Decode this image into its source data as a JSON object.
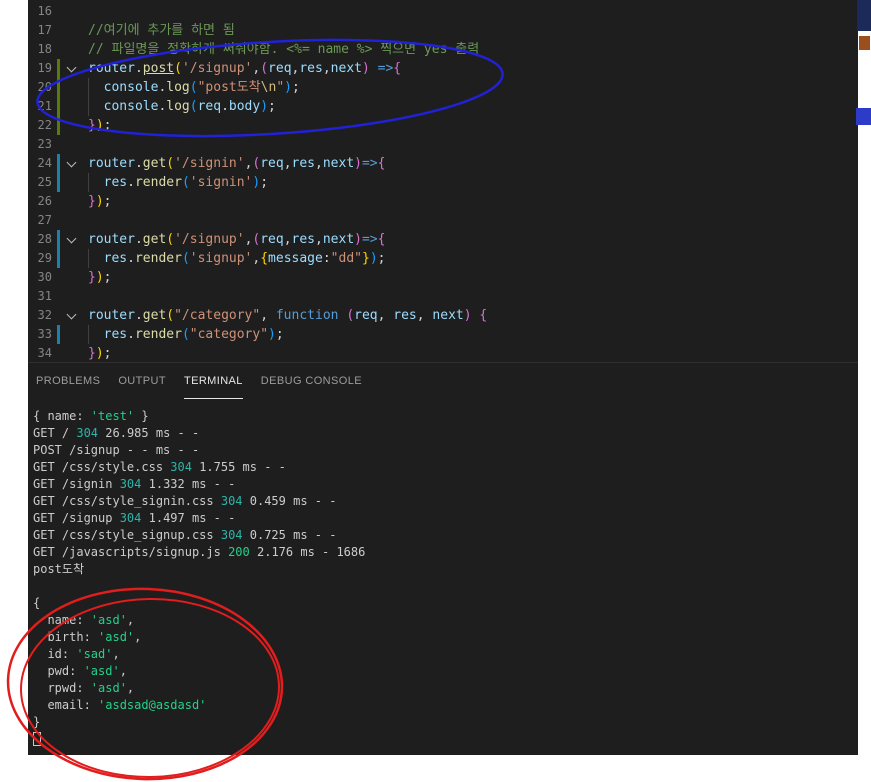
{
  "annotations": {
    "blue_pen_color": "#2121d8",
    "red_pen_color": "#e11d1d"
  },
  "editor": {
    "background": "#1e1e1e",
    "lines": [
      {
        "num": "16",
        "tokens": []
      },
      {
        "num": "17",
        "tokens": [
          {
            "c": "comment",
            "t": "//여기에 추가를 하면 됨"
          }
        ]
      },
      {
        "num": "18",
        "tokens": [
          {
            "c": "comment",
            "t": "// 파일명을 정확하게 써줘야함. <%= name %> 찍으면 yes 출력"
          }
        ]
      },
      {
        "num": "19",
        "gutter": "added",
        "fold": true,
        "tokens": [
          {
            "c": "var",
            "t": "router"
          },
          {
            "c": "def",
            "t": "."
          },
          {
            "c": "func",
            "t": "post",
            "u": true
          },
          {
            "c": "gold",
            "t": "("
          },
          {
            "c": "str",
            "t": "'/signup'"
          },
          {
            "c": "def",
            "t": ","
          },
          {
            "c": "pink",
            "t": "("
          },
          {
            "c": "var",
            "t": "req"
          },
          {
            "c": "def",
            "t": ","
          },
          {
            "c": "var",
            "t": "res"
          },
          {
            "c": "def",
            "t": ","
          },
          {
            "c": "var",
            "t": "next"
          },
          {
            "c": "pink",
            "t": ")"
          },
          {
            "c": "kw",
            "t": " =>"
          },
          {
            "c": "pink",
            "t": "{"
          }
        ]
      },
      {
        "num": "20",
        "gutter": "added",
        "guide": true,
        "tokens": [
          {
            "c": "def",
            "t": "  "
          },
          {
            "c": "var",
            "t": "console"
          },
          {
            "c": "def",
            "t": "."
          },
          {
            "c": "func",
            "t": "log"
          },
          {
            "c": "blue",
            "t": "("
          },
          {
            "c": "str",
            "t": "\"post도착"
          },
          {
            "c": "esc",
            "t": "\\n"
          },
          {
            "c": "str",
            "t": "\""
          },
          {
            "c": "blue",
            "t": ")"
          },
          {
            "c": "def",
            "t": ";"
          }
        ]
      },
      {
        "num": "21",
        "gutter": "added",
        "guide": true,
        "tokens": [
          {
            "c": "def",
            "t": "  "
          },
          {
            "c": "var",
            "t": "console"
          },
          {
            "c": "def",
            "t": "."
          },
          {
            "c": "func",
            "t": "log"
          },
          {
            "c": "blue",
            "t": "("
          },
          {
            "c": "var",
            "t": "req"
          },
          {
            "c": "def",
            "t": "."
          },
          {
            "c": "var",
            "t": "body"
          },
          {
            "c": "blue",
            "t": ")"
          },
          {
            "c": "def",
            "t": ";"
          }
        ]
      },
      {
        "num": "22",
        "gutter": "added",
        "tokens": [
          {
            "c": "pink",
            "t": "}"
          },
          {
            "c": "gold",
            "t": ")"
          },
          {
            "c": "def",
            "t": ";"
          }
        ]
      },
      {
        "num": "23",
        "tokens": []
      },
      {
        "num": "24",
        "gutter": "modified",
        "fold": true,
        "tokens": [
          {
            "c": "var",
            "t": "router"
          },
          {
            "c": "def",
            "t": "."
          },
          {
            "c": "func",
            "t": "get"
          },
          {
            "c": "gold",
            "t": "("
          },
          {
            "c": "str",
            "t": "'/signin'"
          },
          {
            "c": "def",
            "t": ","
          },
          {
            "c": "pink",
            "t": "("
          },
          {
            "c": "var",
            "t": "req"
          },
          {
            "c": "def",
            "t": ","
          },
          {
            "c": "var",
            "t": "res"
          },
          {
            "c": "def",
            "t": ","
          },
          {
            "c": "var",
            "t": "next"
          },
          {
            "c": "pink",
            "t": ")"
          },
          {
            "c": "kw",
            "t": "=>"
          },
          {
            "c": "pink",
            "t": "{"
          }
        ]
      },
      {
        "num": "25",
        "gutter": "modified",
        "guide": true,
        "tokens": [
          {
            "c": "def",
            "t": "  "
          },
          {
            "c": "var",
            "t": "res"
          },
          {
            "c": "def",
            "t": "."
          },
          {
            "c": "func",
            "t": "render"
          },
          {
            "c": "blue",
            "t": "("
          },
          {
            "c": "str",
            "t": "'signin'"
          },
          {
            "c": "blue",
            "t": ")"
          },
          {
            "c": "def",
            "t": ";"
          }
        ]
      },
      {
        "num": "26",
        "tokens": [
          {
            "c": "pink",
            "t": "}"
          },
          {
            "c": "gold",
            "t": ")"
          },
          {
            "c": "def",
            "t": ";"
          }
        ]
      },
      {
        "num": "27",
        "tokens": []
      },
      {
        "num": "28",
        "gutter": "modified",
        "fold": true,
        "tokens": [
          {
            "c": "var",
            "t": "router"
          },
          {
            "c": "def",
            "t": "."
          },
          {
            "c": "func",
            "t": "get"
          },
          {
            "c": "gold",
            "t": "("
          },
          {
            "c": "str",
            "t": "'/signup'"
          },
          {
            "c": "def",
            "t": ","
          },
          {
            "c": "pink",
            "t": "("
          },
          {
            "c": "var",
            "t": "req"
          },
          {
            "c": "def",
            "t": ","
          },
          {
            "c": "var",
            "t": "res"
          },
          {
            "c": "def",
            "t": ","
          },
          {
            "c": "var",
            "t": "next"
          },
          {
            "c": "pink",
            "t": ")"
          },
          {
            "c": "kw",
            "t": "=>"
          },
          {
            "c": "pink",
            "t": "{"
          }
        ]
      },
      {
        "num": "29",
        "gutter": "modified",
        "guide": true,
        "tokens": [
          {
            "c": "def",
            "t": "  "
          },
          {
            "c": "var",
            "t": "res"
          },
          {
            "c": "def",
            "t": "."
          },
          {
            "c": "func",
            "t": "render"
          },
          {
            "c": "blue",
            "t": "("
          },
          {
            "c": "str",
            "t": "'signup'"
          },
          {
            "c": "def",
            "t": ","
          },
          {
            "c": "gold",
            "t": "{"
          },
          {
            "c": "var",
            "t": "message"
          },
          {
            "c": "def",
            "t": ":"
          },
          {
            "c": "str",
            "t": "\"dd\""
          },
          {
            "c": "gold",
            "t": "}"
          },
          {
            "c": "blue",
            "t": ")"
          },
          {
            "c": "def",
            "t": ";"
          }
        ]
      },
      {
        "num": "30",
        "tokens": [
          {
            "c": "pink",
            "t": "}"
          },
          {
            "c": "gold",
            "t": ")"
          },
          {
            "c": "def",
            "t": ";"
          }
        ]
      },
      {
        "num": "31",
        "tokens": []
      },
      {
        "num": "32",
        "fold": true,
        "tokens": [
          {
            "c": "var",
            "t": "router"
          },
          {
            "c": "def",
            "t": "."
          },
          {
            "c": "func",
            "t": "get"
          },
          {
            "c": "gold",
            "t": "("
          },
          {
            "c": "str",
            "t": "\"/category\""
          },
          {
            "c": "def",
            "t": ", "
          },
          {
            "c": "kw",
            "t": "function"
          },
          {
            "c": "def",
            "t": " "
          },
          {
            "c": "pink",
            "t": "("
          },
          {
            "c": "var",
            "t": "req"
          },
          {
            "c": "def",
            "t": ", "
          },
          {
            "c": "var",
            "t": "res"
          },
          {
            "c": "def",
            "t": ", "
          },
          {
            "c": "var",
            "t": "next"
          },
          {
            "c": "pink",
            "t": ")"
          },
          {
            "c": "def",
            "t": " "
          },
          {
            "c": "pink",
            "t": "{"
          }
        ]
      },
      {
        "num": "33",
        "gutter": "modified",
        "guide": true,
        "tokens": [
          {
            "c": "def",
            "t": "  "
          },
          {
            "c": "var",
            "t": "res"
          },
          {
            "c": "def",
            "t": "."
          },
          {
            "c": "func",
            "t": "render"
          },
          {
            "c": "blue",
            "t": "("
          },
          {
            "c": "str",
            "t": "\"category\""
          },
          {
            "c": "blue",
            "t": ")"
          },
          {
            "c": "def",
            "t": ";"
          }
        ]
      },
      {
        "num": "34",
        "tokens": [
          {
            "c": "pink",
            "t": "}"
          },
          {
            "c": "gold",
            "t": ")"
          },
          {
            "c": "def",
            "t": ";"
          }
        ]
      }
    ]
  },
  "panel": {
    "tabs": [
      {
        "label": "PROBLEMS",
        "active": false
      },
      {
        "label": "OUTPUT",
        "active": false
      },
      {
        "label": "TERMINAL",
        "active": true
      },
      {
        "label": "DEBUG CONSOLE",
        "active": false
      }
    ],
    "terminal": [
      [
        {
          "c": "def",
          "t": "{ name: "
        },
        {
          "c": "green",
          "t": "'test'"
        },
        {
          "c": "def",
          "t": " }"
        }
      ],
      [
        {
          "c": "def",
          "t": "GET / "
        },
        {
          "c": "cyan",
          "t": "304"
        },
        {
          "c": "def",
          "t": " 26.985 ms - -"
        }
      ],
      [
        {
          "c": "def",
          "t": "POST /signup - - ms - -"
        }
      ],
      [
        {
          "c": "def",
          "t": "GET /css/style.css "
        },
        {
          "c": "cyan",
          "t": "304"
        },
        {
          "c": "def",
          "t": " 1.755 ms - -"
        }
      ],
      [
        {
          "c": "def",
          "t": "GET /signin "
        },
        {
          "c": "cyan",
          "t": "304"
        },
        {
          "c": "def",
          "t": " 1.332 ms - -"
        }
      ],
      [
        {
          "c": "def",
          "t": "GET /css/style_signin.css "
        },
        {
          "c": "cyan",
          "t": "304"
        },
        {
          "c": "def",
          "t": " 0.459 ms - -"
        }
      ],
      [
        {
          "c": "def",
          "t": "GET /signup "
        },
        {
          "c": "cyan",
          "t": "304"
        },
        {
          "c": "def",
          "t": " 1.497 ms - -"
        }
      ],
      [
        {
          "c": "def",
          "t": "GET /css/style_signup.css "
        },
        {
          "c": "cyan",
          "t": "304"
        },
        {
          "c": "def",
          "t": " 0.725 ms - -"
        }
      ],
      [
        {
          "c": "def",
          "t": "GET /javascripts/signup.js "
        },
        {
          "c": "green",
          "t": "200"
        },
        {
          "c": "def",
          "t": " 2.176 ms - 1686"
        }
      ],
      [
        {
          "c": "def",
          "t": "post도착"
        }
      ],
      [],
      [
        {
          "c": "def",
          "t": "{"
        }
      ],
      [
        {
          "c": "def",
          "t": "  name: "
        },
        {
          "c": "green",
          "t": "'asd'"
        },
        {
          "c": "def",
          "t": ","
        }
      ],
      [
        {
          "c": "def",
          "t": "  birth: "
        },
        {
          "c": "green",
          "t": "'asd'"
        },
        {
          "c": "def",
          "t": ","
        }
      ],
      [
        {
          "c": "def",
          "t": "  id: "
        },
        {
          "c": "green",
          "t": "'sad'"
        },
        {
          "c": "def",
          "t": ","
        }
      ],
      [
        {
          "c": "def",
          "t": "  pwd: "
        },
        {
          "c": "green",
          "t": "'asd'"
        },
        {
          "c": "def",
          "t": ","
        }
      ],
      [
        {
          "c": "def",
          "t": "  rpwd: "
        },
        {
          "c": "green",
          "t": "'asd'"
        },
        {
          "c": "def",
          "t": ","
        }
      ],
      [
        {
          "c": "def",
          "t": "  email: "
        },
        {
          "c": "green",
          "t": "'asdsad@asdasd'"
        }
      ],
      [
        {
          "c": "def",
          "t": "}"
        }
      ]
    ],
    "cursor_visible": true
  }
}
